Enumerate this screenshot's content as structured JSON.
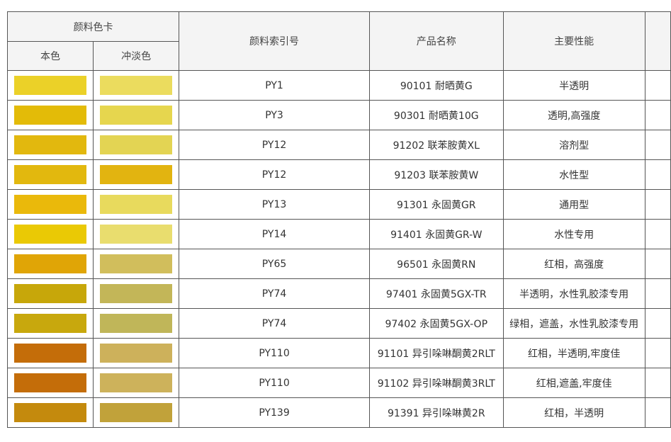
{
  "header": {
    "group": "颜料色卡",
    "self_color": "本色",
    "tint_color": "冲淡色",
    "index": "颜料索引号",
    "product": "产品名称",
    "property": "主要性能"
  },
  "rows": [
    {
      "self": "#ebd128",
      "tint": "#ebdc5e",
      "index": "PY1",
      "product": "90101 耐晒黄G",
      "property": "半透明"
    },
    {
      "self": "#e3bb08",
      "tint": "#e6d64e",
      "index": "PY3",
      "product": "90301 耐晒黄10G",
      "property": "透明,高强度"
    },
    {
      "self": "#e2b80e",
      "tint": "#e3d453",
      "index": "PY12",
      "product": "91202 联苯胺黄XL",
      "property": "溶剂型"
    },
    {
      "self": "#e2b80e",
      "tint": "#e2b410",
      "index": "PY12",
      "product": "91203 联苯胺黄W",
      "property": "水性型"
    },
    {
      "self": "#eab90b",
      "tint": "#e8da5d",
      "index": "PY13",
      "product": "91301 永固黄GR",
      "property": "通用型"
    },
    {
      "self": "#eac905",
      "tint": "#e9dd6e",
      "index": "PY14",
      "product": "91401 永固黄GR-W",
      "property": "水性专用"
    },
    {
      "self": "#e0a506",
      "tint": "#d1be5c",
      "index": "PY65",
      "product": "96501 永固黄RN",
      "property": "红相，高强度"
    },
    {
      "self": "#c7a70a",
      "tint": "#c3b658",
      "index": "PY74",
      "product": "97401 永固黄5GX-TR",
      "property": "半透明，水性乳胶漆专用"
    },
    {
      "self": "#c8a80d",
      "tint": "#c0b659",
      "index": "PY74",
      "product": "97402 永固黄5GX-OP",
      "property": "绿相，遮盖，水性乳胶漆专用"
    },
    {
      "self": "#c46d09",
      "tint": "#cdb15b",
      "index": "PY110",
      "product": "91101 异引哚啉酮黄2RLT",
      "property": "红相，半透明,牢度佳"
    },
    {
      "self": "#c46d09",
      "tint": "#cdb25b",
      "index": "PY110",
      "product": "91102 异引哚啉酮黄3RLT",
      "property": "红相,遮盖,牢度佳"
    },
    {
      "self": "#c48a0d",
      "tint": "#c1a23a",
      "index": "PY139",
      "product": "91391 异引哚啉黄2R",
      "property": "红相，半透明"
    }
  ]
}
